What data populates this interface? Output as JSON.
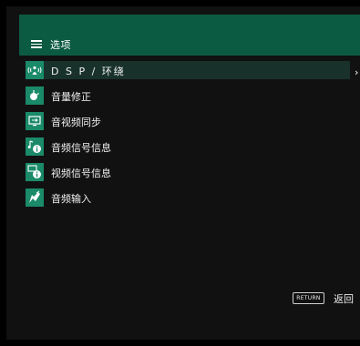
{
  "header": {
    "title": "选项"
  },
  "menu": {
    "items": [
      {
        "label": "D S P / 环绕",
        "icon": "dsp-surround-icon"
      },
      {
        "label": "音量修正",
        "icon": "volume-icon"
      },
      {
        "label": "音视频同步",
        "icon": "av-sync-icon"
      },
      {
        "label": "音频信号信息",
        "icon": "audio-info-icon"
      },
      {
        "label": "视频信号信息",
        "icon": "video-info-icon"
      },
      {
        "label": "音频输入",
        "icon": "audio-input-icon"
      }
    ],
    "selected_index": 0
  },
  "footer": {
    "return_key": "RETURN",
    "return_label": "返回"
  },
  "colors": {
    "header_bg": "#0b5a42",
    "icon_bg": "#1a8a68",
    "selected_bg": "#18322b"
  }
}
